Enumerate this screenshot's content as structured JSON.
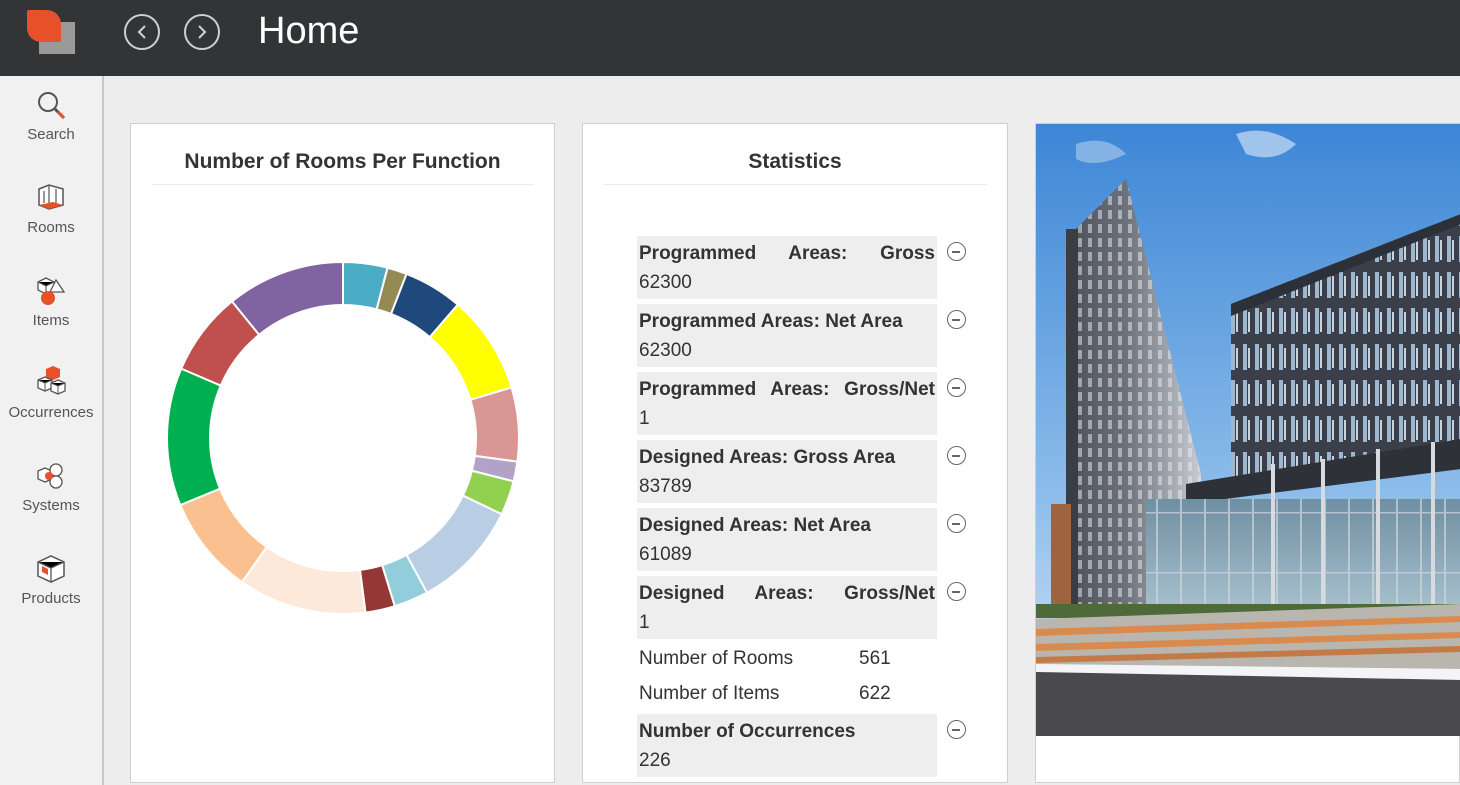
{
  "header": {
    "title": "Home"
  },
  "sidebar": {
    "items": [
      {
        "label": "Search",
        "icon": "search-icon"
      },
      {
        "label": "Rooms",
        "icon": "rooms-icon"
      },
      {
        "label": "Items",
        "icon": "items-icon"
      },
      {
        "label": "Occurrences",
        "icon": "occurrences-icon"
      },
      {
        "label": "Systems",
        "icon": "systems-icon"
      },
      {
        "label": "Products",
        "icon": "products-icon"
      }
    ]
  },
  "chart_card": {
    "title": "Number of Rooms Per Function"
  },
  "chart_data": {
    "type": "pie",
    "donut": true,
    "values": [
      4.5,
      2,
      6,
      10,
      7.5,
      2,
      3.5,
      11,
      3.5,
      3,
      13,
      10,
      14,
      8.5,
      12
    ],
    "colors": [
      "#4bacc6",
      "#948a54",
      "#1f497d",
      "#ffff00",
      "#d99694",
      "#b3a2c7",
      "#92d050",
      "#b9cde5",
      "#92cddc",
      "#953735",
      "#fde9d9",
      "#fac08f",
      "#00b050",
      "#c0504d",
      "#8064a2"
    ]
  },
  "stats_card": {
    "title": "Statistics",
    "rows": [
      {
        "label": "Programmed Areas: Gross",
        "value": "62300"
      },
      {
        "label": "Programmed Areas: Net Area",
        "value": "62300"
      },
      {
        "label": "Programmed Areas: Gross/Net",
        "value": "1"
      },
      {
        "label": "Designed Areas: Gross Area",
        "value": "83789"
      },
      {
        "label": "Designed Areas: Net Area",
        "value": "61089"
      },
      {
        "label": "Designed Areas: Gross/Net",
        "value": "1"
      },
      {
        "label": "Number of Rooms",
        "value": "561"
      },
      {
        "label": "Number of Items",
        "value": "622"
      },
      {
        "label": "Number of Occurrences",
        "value": "226"
      }
    ]
  },
  "colors": {
    "topbar": "#333436",
    "brand": "#e8502a"
  }
}
